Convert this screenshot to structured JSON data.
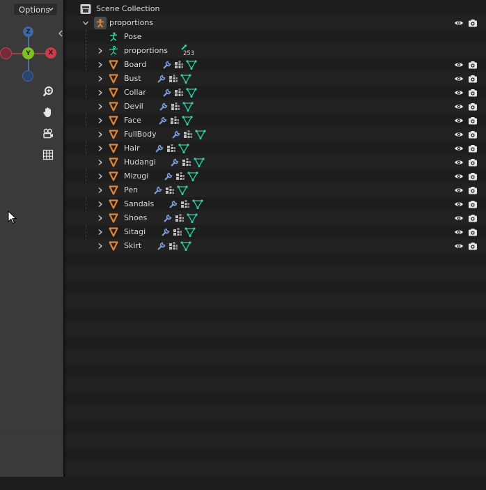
{
  "viewport": {
    "options_label": "Options",
    "gizmo": {
      "z": "Z",
      "y": "Y",
      "x": "X"
    },
    "colors": {
      "x": "#d03a4c",
      "y": "#7dc221",
      "z": "#3e69a8"
    }
  },
  "outliner": {
    "root": "Scene Collection",
    "collection": "proportions",
    "pose": "Pose",
    "armature": "proportions",
    "bone_count": "253",
    "objects": [
      {
        "name": "Board"
      },
      {
        "name": "Bust"
      },
      {
        "name": "Collar"
      },
      {
        "name": "Devil"
      },
      {
        "name": "Face"
      },
      {
        "name": "FullBody"
      },
      {
        "name": "Hair"
      },
      {
        "name": "Hudangi"
      },
      {
        "name": "Mizugi"
      },
      {
        "name": "Pen"
      },
      {
        "name": "Sandals"
      },
      {
        "name": "Shoes"
      },
      {
        "name": "Sitagi"
      },
      {
        "name": "Skirt"
      }
    ],
    "colors": {
      "mesh": "#e0853a",
      "modifier": "#7d9bd9",
      "data": "#31d0a0"
    }
  }
}
